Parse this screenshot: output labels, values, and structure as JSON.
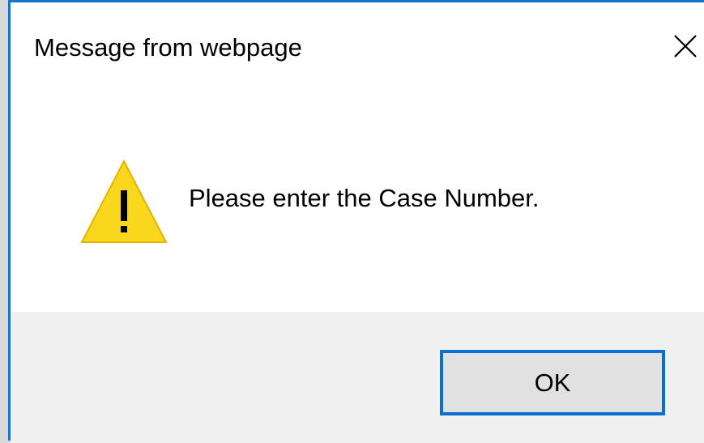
{
  "dialog": {
    "title": "Message from webpage",
    "close_icon": "close-icon",
    "icon": "warning-icon",
    "message": "Please enter the Case Number.",
    "ok_label": "OK"
  },
  "colors": {
    "border_accent": "#1a73c8",
    "button_focus_border": "#0a6fd4",
    "warning_fill": "#f9d71c",
    "footer_bg": "#f0f0f0"
  }
}
